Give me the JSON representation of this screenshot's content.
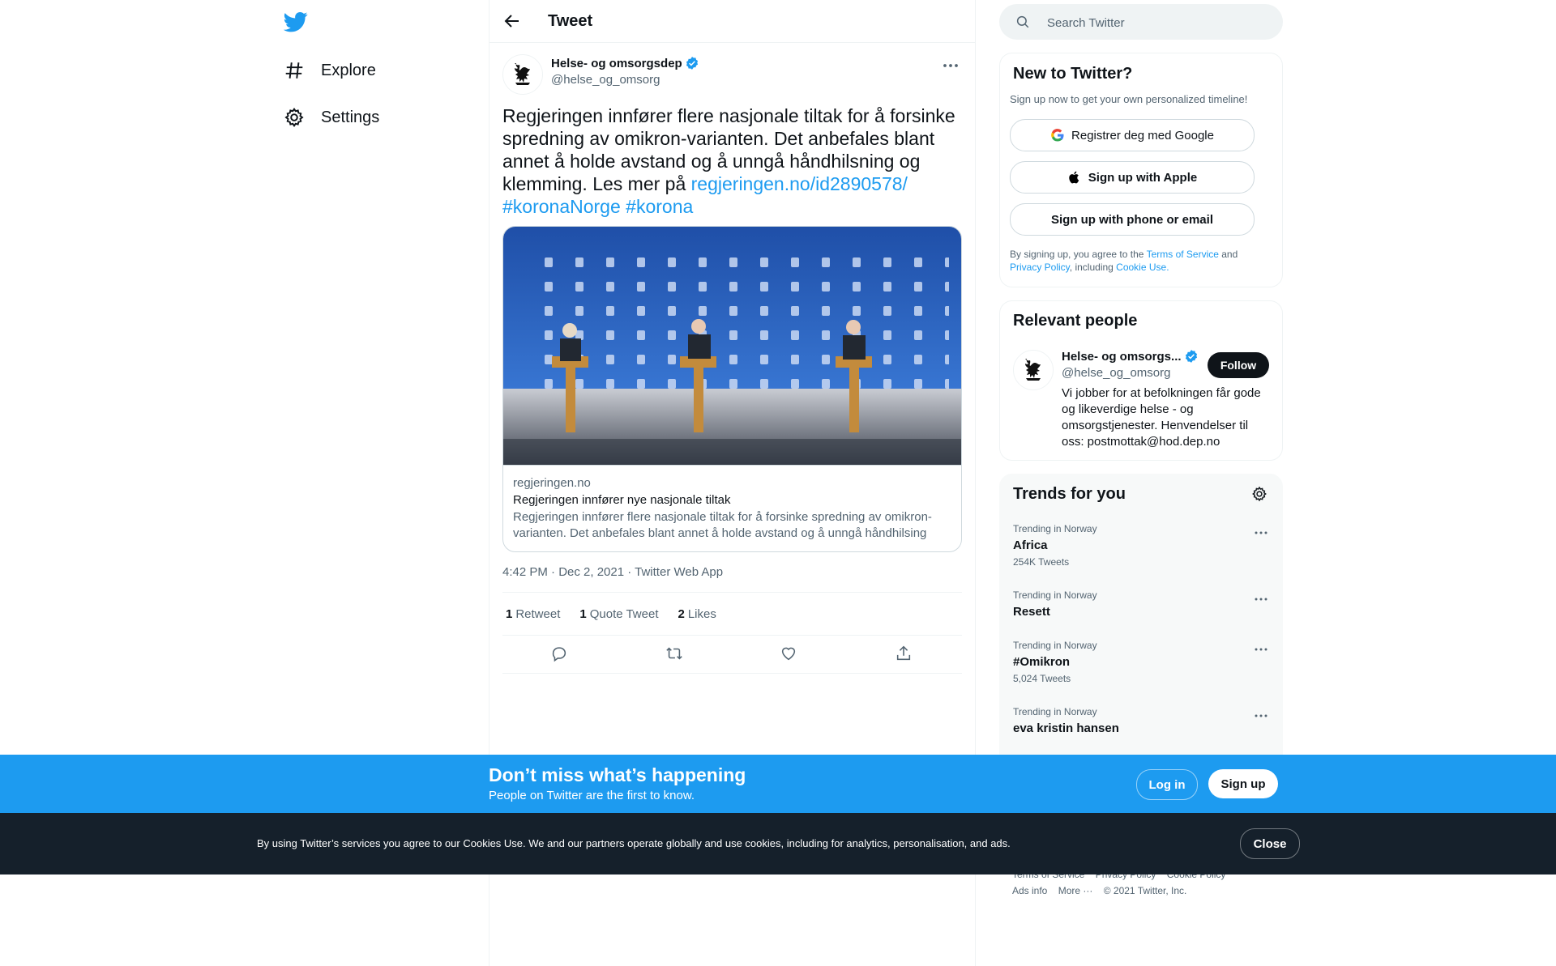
{
  "colors": {
    "accent": "#1d9bf0",
    "text": "#0f1419",
    "muted": "#536471",
    "cookie_bar": "#15202b"
  },
  "nav": {
    "items": [
      {
        "label": "Explore",
        "icon": "hashtag-icon"
      },
      {
        "label": "Settings",
        "icon": "gear-icon"
      }
    ]
  },
  "header": {
    "title": "Tweet"
  },
  "tweet": {
    "author_name": "Helse- og omsorgsdep",
    "author_handle": "@helse_og_omsorg",
    "text_plain": "Regjeringen innfører flere nasjonale tiltak for å forsinke spredning av omikron-varianten. Det anbefales blant annet å holde avstand og å unngå håndhilsning og klemming. Les mer på ",
    "link": "regjeringen.no/id2890578/",
    "hashtag_1": "#koronaNorge",
    "hashtag_2": "#korona",
    "card": {
      "domain": "regjeringen.no",
      "title": "Regjeringen innfører nye nasjonale tiltak",
      "description": "Regjeringen innfører flere nasjonale tiltak for å forsinke spredning av omikron-varianten. Det anbefales blant annet å holde avstand og å unngå håndhilsing og..."
    },
    "meta": "4:42 PM · Dec 2, 2021 · Twitter Web App",
    "stats": [
      {
        "count": "1",
        "label": "Retweet"
      },
      {
        "count": "1",
        "label": "Quote Tweet"
      },
      {
        "count": "2",
        "label": "Likes"
      }
    ]
  },
  "search": {
    "placeholder": "Search Twitter"
  },
  "signup": {
    "title": "New to Twitter?",
    "subtitle": "Sign up now to get your own personalized timeline!",
    "google": "Registrer deg med Google",
    "apple": "Sign up with Apple",
    "phone": "Sign up with phone or email",
    "terms_1": "By signing up, you agree to the ",
    "terms_tos": "Terms of Service",
    "terms_2": " and ",
    "terms_privacy": "Privacy Policy",
    "terms_3": ", including ",
    "terms_cookie": "Cookie Use."
  },
  "relevant": {
    "title": "Relevant people",
    "name": "Helse- og omsorgs...",
    "handle": "@helse_og_omsorg",
    "follow": "Follow",
    "bio": "Vi jobber for at befolkningen får gode og likeverdige helse - og omsorgstjenester. Henvendelser til oss: postmottak@hod.dep.no"
  },
  "trends": {
    "title": "Trends for you",
    "items": [
      {
        "context": "Trending in Norway",
        "name": "Africa",
        "count": "254K Tweets"
      },
      {
        "context": "Trending in Norway",
        "name": "Resett",
        "count": ""
      },
      {
        "context": "Trending in Norway",
        "name": "#Omikron",
        "count": "5,024 Tweets"
      },
      {
        "context": "Trending in Norway",
        "name": "eva kristin hansen",
        "count": ""
      }
    ]
  },
  "footer": {
    "terms": "Terms of Service",
    "privacy": "Privacy Policy",
    "cookie": "Cookie Policy",
    "ads": "Ads info",
    "more": "More ···",
    "copyright": "© 2021 Twitter, Inc."
  },
  "bottom_bar": {
    "title": "Don’t miss what’s happening",
    "subtitle": "People on Twitter are the first to know.",
    "login": "Log in",
    "signup": "Sign up"
  },
  "cookie_bar": {
    "text": "By using Twitter’s services you agree to our Cookies Use. We and our partners operate globally and use cookies, including for analytics, personalisation, and ads.",
    "close": "Close"
  }
}
